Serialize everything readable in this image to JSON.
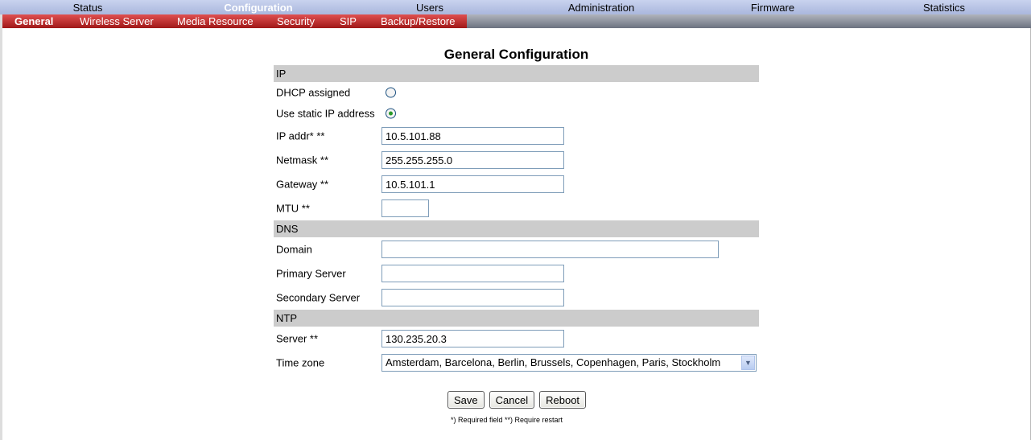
{
  "topnav": {
    "items": [
      "Status",
      "Configuration",
      "Users",
      "Administration",
      "Firmware",
      "Statistics"
    ],
    "active": "Configuration"
  },
  "subnav": {
    "items": [
      "General",
      "Wireless Server",
      "Media Resource",
      "Security",
      "SIP",
      "Backup/Restore"
    ],
    "active": "General"
  },
  "page_title": "General Configuration",
  "ip": {
    "header": "IP",
    "dhcp_label": "DHCP assigned",
    "dhcp_selected": false,
    "static_label": "Use static IP address",
    "static_selected": true,
    "ip_label": "IP addr* **",
    "ip_value": "10.5.101.88",
    "netmask_label": "Netmask **",
    "netmask_value": "255.255.255.0",
    "gateway_label": "Gateway **",
    "gateway_value": "10.5.101.1",
    "mtu_label": "MTU **",
    "mtu_value": ""
  },
  "dns": {
    "header": "DNS",
    "domain_label": "Domain",
    "domain_value": "",
    "primary_label": "Primary Server",
    "primary_value": "",
    "secondary_label": "Secondary Server",
    "secondary_value": ""
  },
  "ntp": {
    "header": "NTP",
    "server_label": "Server **",
    "server_value": "130.235.20.3",
    "timezone_label": "Time zone",
    "timezone_value": "Amsterdam, Barcelona, Berlin, Brussels, Copenhagen, Paris, Stockholm"
  },
  "buttons": {
    "save": "Save",
    "cancel": "Cancel",
    "reboot": "Reboot"
  },
  "footnote": "*) Required field **) Require restart"
}
